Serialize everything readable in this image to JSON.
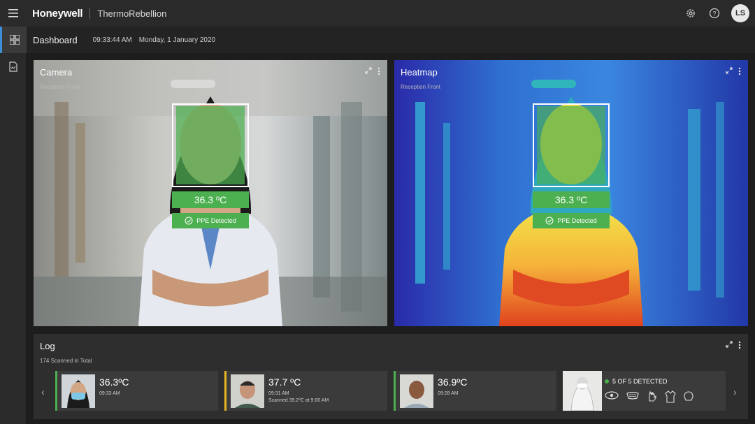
{
  "header": {
    "brand": "Honeywell",
    "product": "ThermoRebellion",
    "avatar_initials": "LS"
  },
  "subheader": {
    "title": "Dashboard",
    "time": "09:33:44 AM",
    "date": "Monday, 1 January 2020"
  },
  "camera": {
    "title": "Camera",
    "location": "Reception Front",
    "temperature": "36.3 ºC",
    "ppe_status": "PPE Detected"
  },
  "heatmap": {
    "title": "Heatmap",
    "location": "Reception Front",
    "temperature": "36.3 ºC",
    "ppe_status": "PPE Detected"
  },
  "log": {
    "title": "Log",
    "total": "174 Scanned in Total",
    "entries": [
      {
        "temperature": "36.3ºC",
        "time": "09:33 AM",
        "note": "",
        "status_color": "#4caf50"
      },
      {
        "temperature": "37.7 ºC",
        "time": "09:31 AM",
        "note": "Scanned 39.2ºC at 9:00 AM",
        "status_color": "#e6b422"
      },
      {
        "temperature": "36.9ºC",
        "time": "09:28 AM",
        "note": "",
        "status_color": "#4caf50"
      }
    ],
    "ppe": {
      "label": "5 OF 5 DETECTED",
      "items": [
        "goggles-icon",
        "mask-icon",
        "glove-icon",
        "gown-icon",
        "cap-icon"
      ]
    }
  },
  "colors": {
    "accent": "#3c8fd8",
    "ok": "#4caf50",
    "warn": "#e6b422"
  }
}
